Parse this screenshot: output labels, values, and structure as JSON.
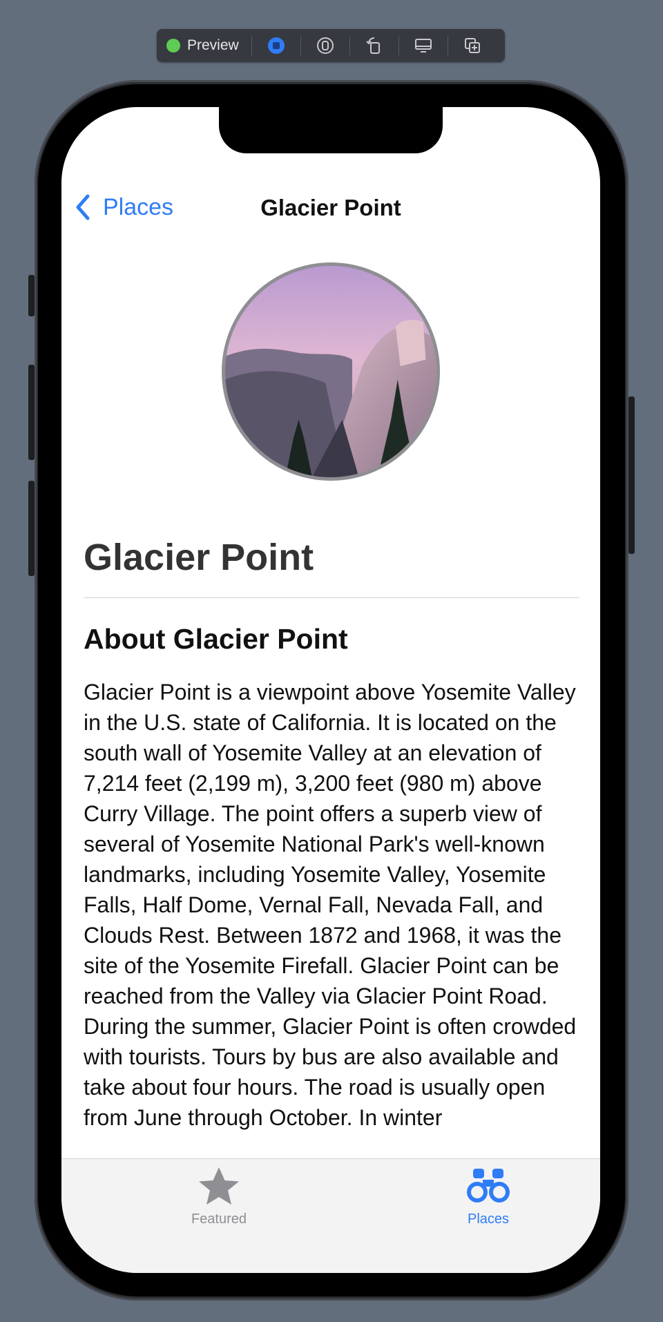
{
  "toolbar": {
    "preview_label": "Preview",
    "live_color": "#5ecb55",
    "buttons": [
      "live-mode-icon",
      "variants-icon",
      "rotate-device-icon",
      "device-settings-icon",
      "duplicate-preview-icon"
    ]
  },
  "nav": {
    "back_label": "Places",
    "title": "Glacier Point"
  },
  "place": {
    "name": "Glacier Point",
    "about_title": "About Glacier Point",
    "description": "Glacier Point is a viewpoint above Yosemite Valley in the U.S. state of California. It is located on the south wall of Yosemite Valley at an elevation of 7,214 feet (2,199 m), 3,200 feet (980 m) above Curry Village. The point offers a superb view of several of Yosemite National Park's well-known landmarks, including Yosemite Valley, Yosemite Falls, Half Dome, Vernal Fall, Nevada Fall, and Clouds Rest. Between 1872 and 1968, it was the site of the Yosemite Firefall. Glacier Point can be reached from the Valley via Glacier Point Road. During the summer, Glacier Point is often crowded with tourists. Tours by bus are also available and take about four hours. The road is usually open from June through October. In winter"
  },
  "tabs": [
    {
      "label": "Featured",
      "icon": "star-icon",
      "selected": false
    },
    {
      "label": "Places",
      "icon": "binoculars-icon",
      "selected": true
    }
  ],
  "colors": {
    "accent": "#2f7cf6",
    "tab_inactive": "#8e8e93",
    "background": "#636e7d"
  }
}
